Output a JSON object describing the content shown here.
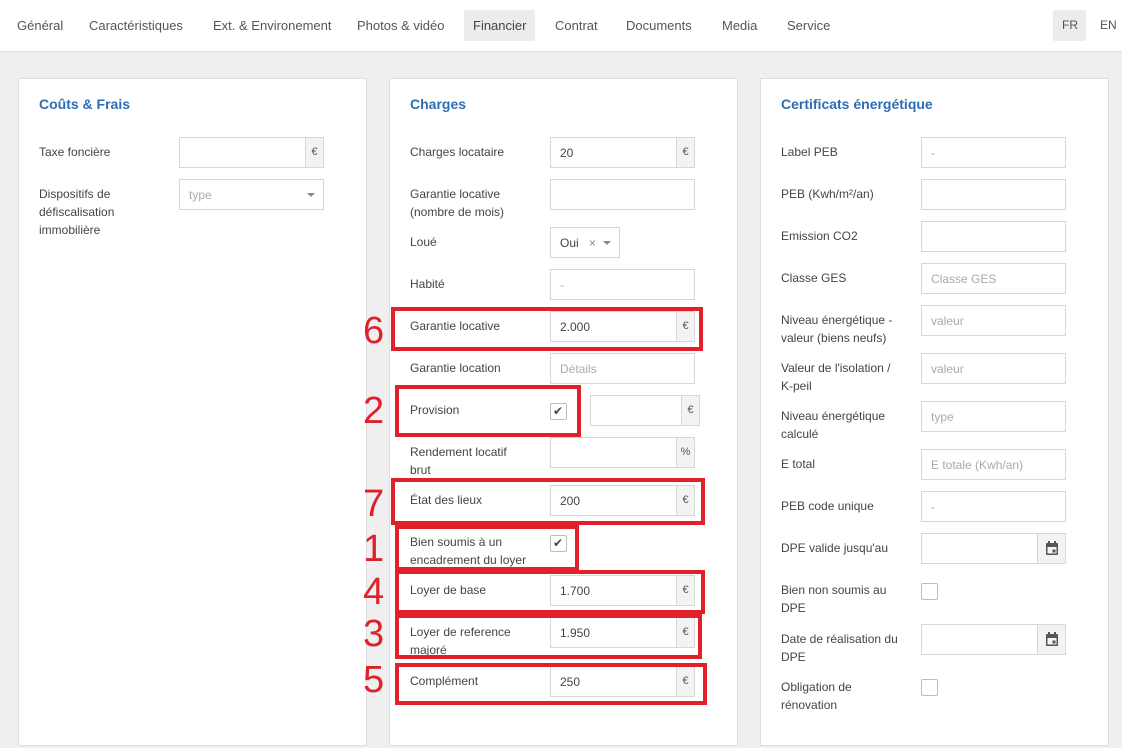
{
  "tabs": [
    {
      "label": "Général"
    },
    {
      "label": "Caractéristiques"
    },
    {
      "label": "Ext. & Environement"
    },
    {
      "label": "Photos & vidéo"
    },
    {
      "label": "Financier"
    },
    {
      "label": "Contrat"
    },
    {
      "label": "Documents"
    },
    {
      "label": "Media"
    },
    {
      "label": "Service"
    }
  ],
  "active_tab": "Financier",
  "languages": [
    "FR",
    "EN"
  ],
  "active_language": "FR",
  "couts": {
    "title": "Coûts & Frais",
    "taxe_label": "Taxe foncière",
    "taxe_suffix": "€",
    "dispositifs_label_1": "Dispositifs de",
    "dispositifs_label_2": "défiscalisation",
    "dispositifs_label_3": "immobilière",
    "dispositifs_placeholder": "type"
  },
  "charges": {
    "title": "Charges",
    "charges_locataire_label": "Charges locataire",
    "charges_locataire_value": "20",
    "garantie_mois_label_1": "Garantie locative",
    "garantie_mois_label_2": "(nombre de mois)",
    "loue_label": "Loué",
    "loue_value": "Oui",
    "loue_clear": "×",
    "habite_label": "Habité",
    "habite_placeholder": "-",
    "garantie_locative_label": "Garantie locative",
    "garantie_locative_value": "2.000",
    "garantie_location_label": "Garantie location",
    "garantie_location_placeholder": "Détails",
    "provision_label": "Provision",
    "provision_checked": true,
    "rendement_label_1": "Rendement locatif",
    "rendement_label_2": "brut",
    "rendement_suffix": "%",
    "etat_label": "État des lieux",
    "etat_value": "200",
    "bien_soumis_label_1": "Bien soumis à un",
    "bien_soumis_label_2": "encadrement du loyer",
    "bien_soumis_checked": true,
    "loyer_base_label": "Loyer de base",
    "loyer_base_value": "1.700",
    "loyer_ref_label_1": "Loyer de reference",
    "loyer_ref_label_2": "majoré",
    "loyer_ref_value": "1.950",
    "complement_label": "Complément",
    "complement_value": "250",
    "currency": "€"
  },
  "certificats": {
    "title": "Certificats énergétique",
    "label_peb": "Label PEB",
    "label_peb_placeholder": "-",
    "peb_kwh": "PEB (Kwh/m²/an)",
    "emission": "Emission CO2",
    "classe_ges": "Classe GES",
    "classe_ges_placeholder": "Classe GES",
    "niveau_1": "Niveau énergétique -",
    "niveau_2": "valeur (biens neufs)",
    "niveau_placeholder": "valeur",
    "isolation_1": "Valeur de l'isolation /",
    "isolation_2": "K-peil",
    "isolation_placeholder": "valeur",
    "calcule_1": "Niveau énergétique",
    "calcule_2": "calculé",
    "calcule_placeholder": "type",
    "etotal": "E total",
    "etotal_placeholder": "E totale (Kwh/an)",
    "peb_code": "PEB code unique",
    "peb_code_placeholder": "-",
    "dpe_valide": "DPE valide jusqu'au",
    "bien_non_soumis_1": "Bien non soumis au",
    "bien_non_soumis_2": "DPE",
    "date_dpe_1": "Date de réalisation du",
    "date_dpe_2": "DPE",
    "obligation_1": "Obligation de",
    "obligation_2": "rénovation"
  },
  "annotations": {
    "n1": "1",
    "n2": "2",
    "n3": "3",
    "n4": "4",
    "n5": "5",
    "n6": "6",
    "n7": "7",
    "color": "#e0212b"
  }
}
